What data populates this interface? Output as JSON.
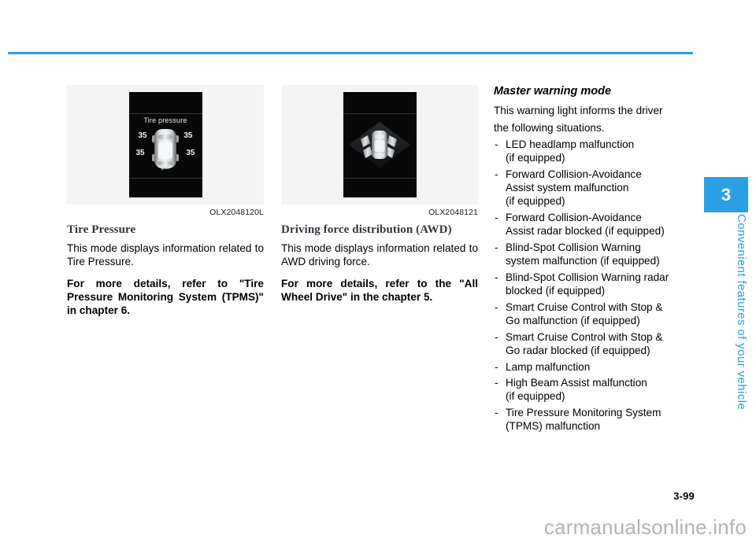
{
  "theme": {
    "accent": "#2a9fe4",
    "heading_serif_color": "#33363d",
    "figure_bg": "#f4f4f4",
    "lcd_bg": "#080808",
    "watermark_color": "#b3b3b3"
  },
  "chapter_tab": {
    "number": "3",
    "label": "Convenient features of your vehicle"
  },
  "footer": {
    "page_number": "3-99",
    "watermark": "carmanualsonline.info"
  },
  "figures": {
    "tire_pressure": {
      "caption": "OLX2048120L",
      "screen": {
        "title": "Tire pressure",
        "unit": "psi",
        "values": {
          "front_left": "35",
          "front_right": "35",
          "rear_left": "35",
          "rear_right": "35"
        }
      }
    },
    "awd": {
      "caption": "OLX2048121",
      "screen": {
        "title": ""
      }
    }
  },
  "columns": {
    "left": {
      "heading": "Tire Pressure",
      "paragraph": "This mode displays information related to Tire Pressure.",
      "bold_note": "For more details, refer to \"Tire Pressure Monitoring System (TPMS)\" in chapter 6."
    },
    "middle": {
      "heading": "Driving force distribution (AWD)",
      "paragraph": "This mode displays information related to AWD driving force.",
      "bold_note": "For more details, refer to the \"All Wheel Drive\" in the chapter 5."
    },
    "right": {
      "heading": "Master warning mode",
      "intro_line1": "This warning light informs the driver",
      "intro_line2": "the following situations.",
      "dash": "-",
      "items": [
        "LED headlamp malfunction\n(if equipped)",
        "Forward Collision-Avoidance\nAssist system malfunction\n(if equipped)",
        "Forward Collision-Avoidance\nAssist radar blocked (if equipped)",
        "Blind-Spot Collision Warning\nsystem malfunction (if equipped)",
        "Blind-Spot Collision Warning radar\nblocked (if equipped)",
        "Smart Cruise Control with Stop &\nGo malfunction (if equipped)",
        "Smart Cruise Control with Stop &\nGo radar blocked (if equipped)",
        "Lamp malfunction",
        "High Beam Assist malfunction\n(if equipped)",
        "Tire Pressure Monitoring System\n(TPMS) malfunction"
      ]
    }
  }
}
